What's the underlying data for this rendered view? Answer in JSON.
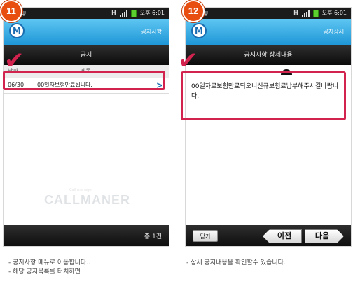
{
  "status": {
    "network": "H",
    "time": "오후 6:01"
  },
  "app": {
    "logo_letter": "M"
  },
  "screen1": {
    "step": "11",
    "title": "공지사항",
    "section": "공지",
    "columns": [
      "날짜",
      "제목"
    ],
    "row": {
      "date": "06/30",
      "title": "00일자보험만료됩니다."
    },
    "watermark": "CALLMANER",
    "watermark_sub": "Call manager",
    "total": "총 1건"
  },
  "screen2": {
    "step": "12",
    "title": "공지상세",
    "section": "공지사항 상세내용",
    "detail_text": "00일자로보험만료되오니신규보험료납부해주시길바랍니다.",
    "close_label": "닫기",
    "prev_label": "이전",
    "next_label": "다음"
  },
  "captions": {
    "left_line1": "- 공지사항 메뉴로 이동합니다..",
    "left_line2": "- 해당 공지목록를 터치하면",
    "right_line1": "- 상세 공지내용을 확인할수 있습니다."
  },
  "colors": {
    "accent": "#1d95d6",
    "highlight": "#d2234f",
    "badge": "#e84e0f"
  },
  "icons": {
    "usb": "usb-icon",
    "signal": "signal-icon",
    "battery": "battery-icon",
    "chevron": "chevron-right-icon",
    "check": "check-mark-icon"
  }
}
